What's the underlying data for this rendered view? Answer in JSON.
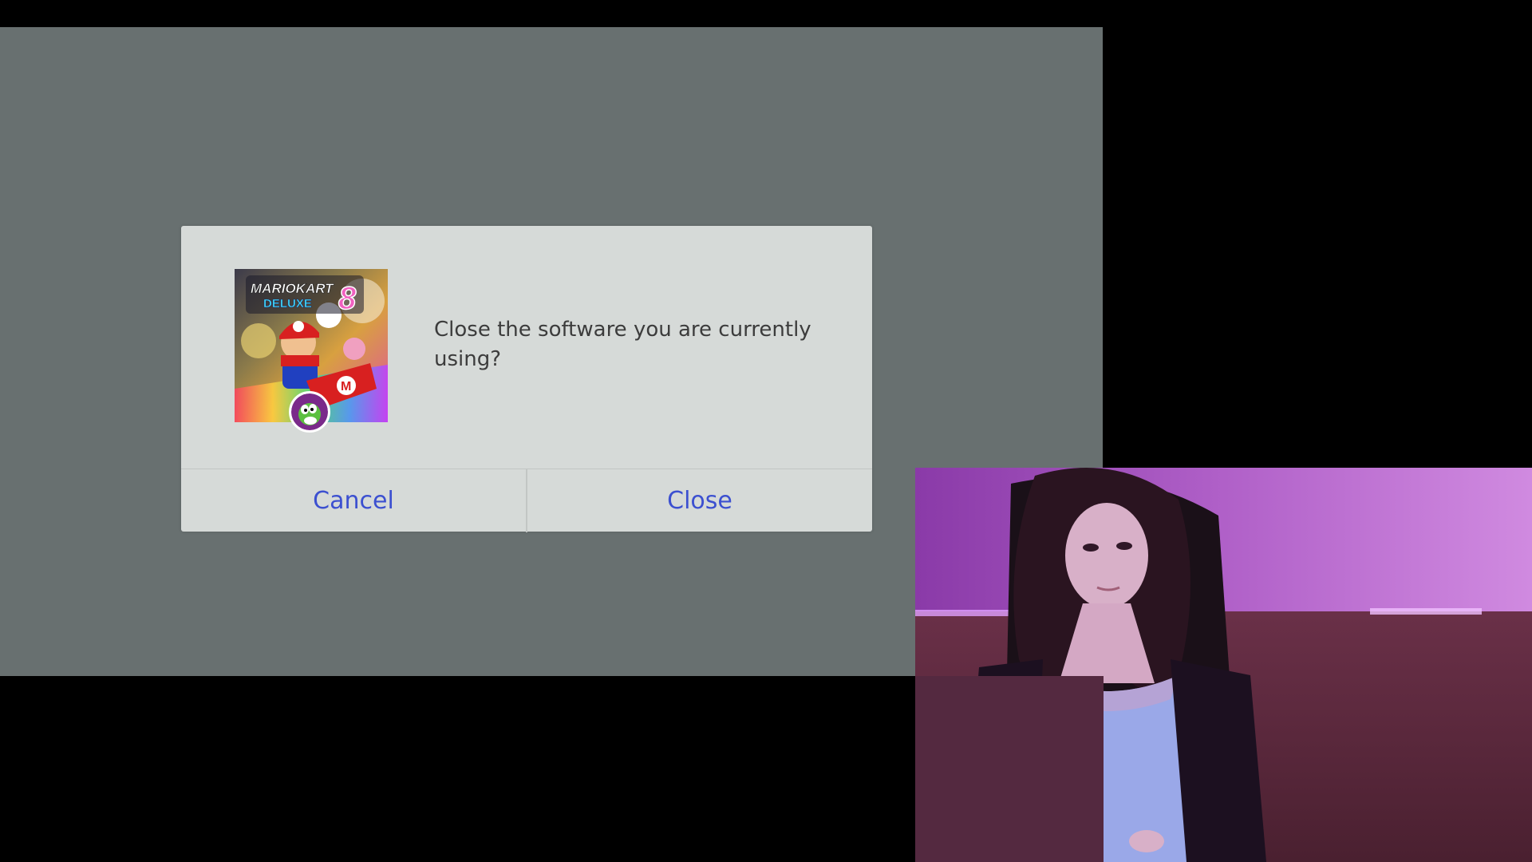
{
  "dialog": {
    "message": "Close the software you are currently using?",
    "cancel_label": "Cancel",
    "close_label": "Close",
    "icon": "mario-kart-8-deluxe-game-icon",
    "game_title_art": "MARIOKART 8 DELUXE",
    "user_avatar_icon": "yoshi-avatar-icon"
  },
  "colors": {
    "overlay_background": "#687070",
    "dialog_background": "#d6dad8",
    "button_text": "#3c50d0",
    "message_text": "#3c3c3c",
    "stage_background": "#000000"
  },
  "webcam": {
    "icon": "webcam-feed-image"
  }
}
